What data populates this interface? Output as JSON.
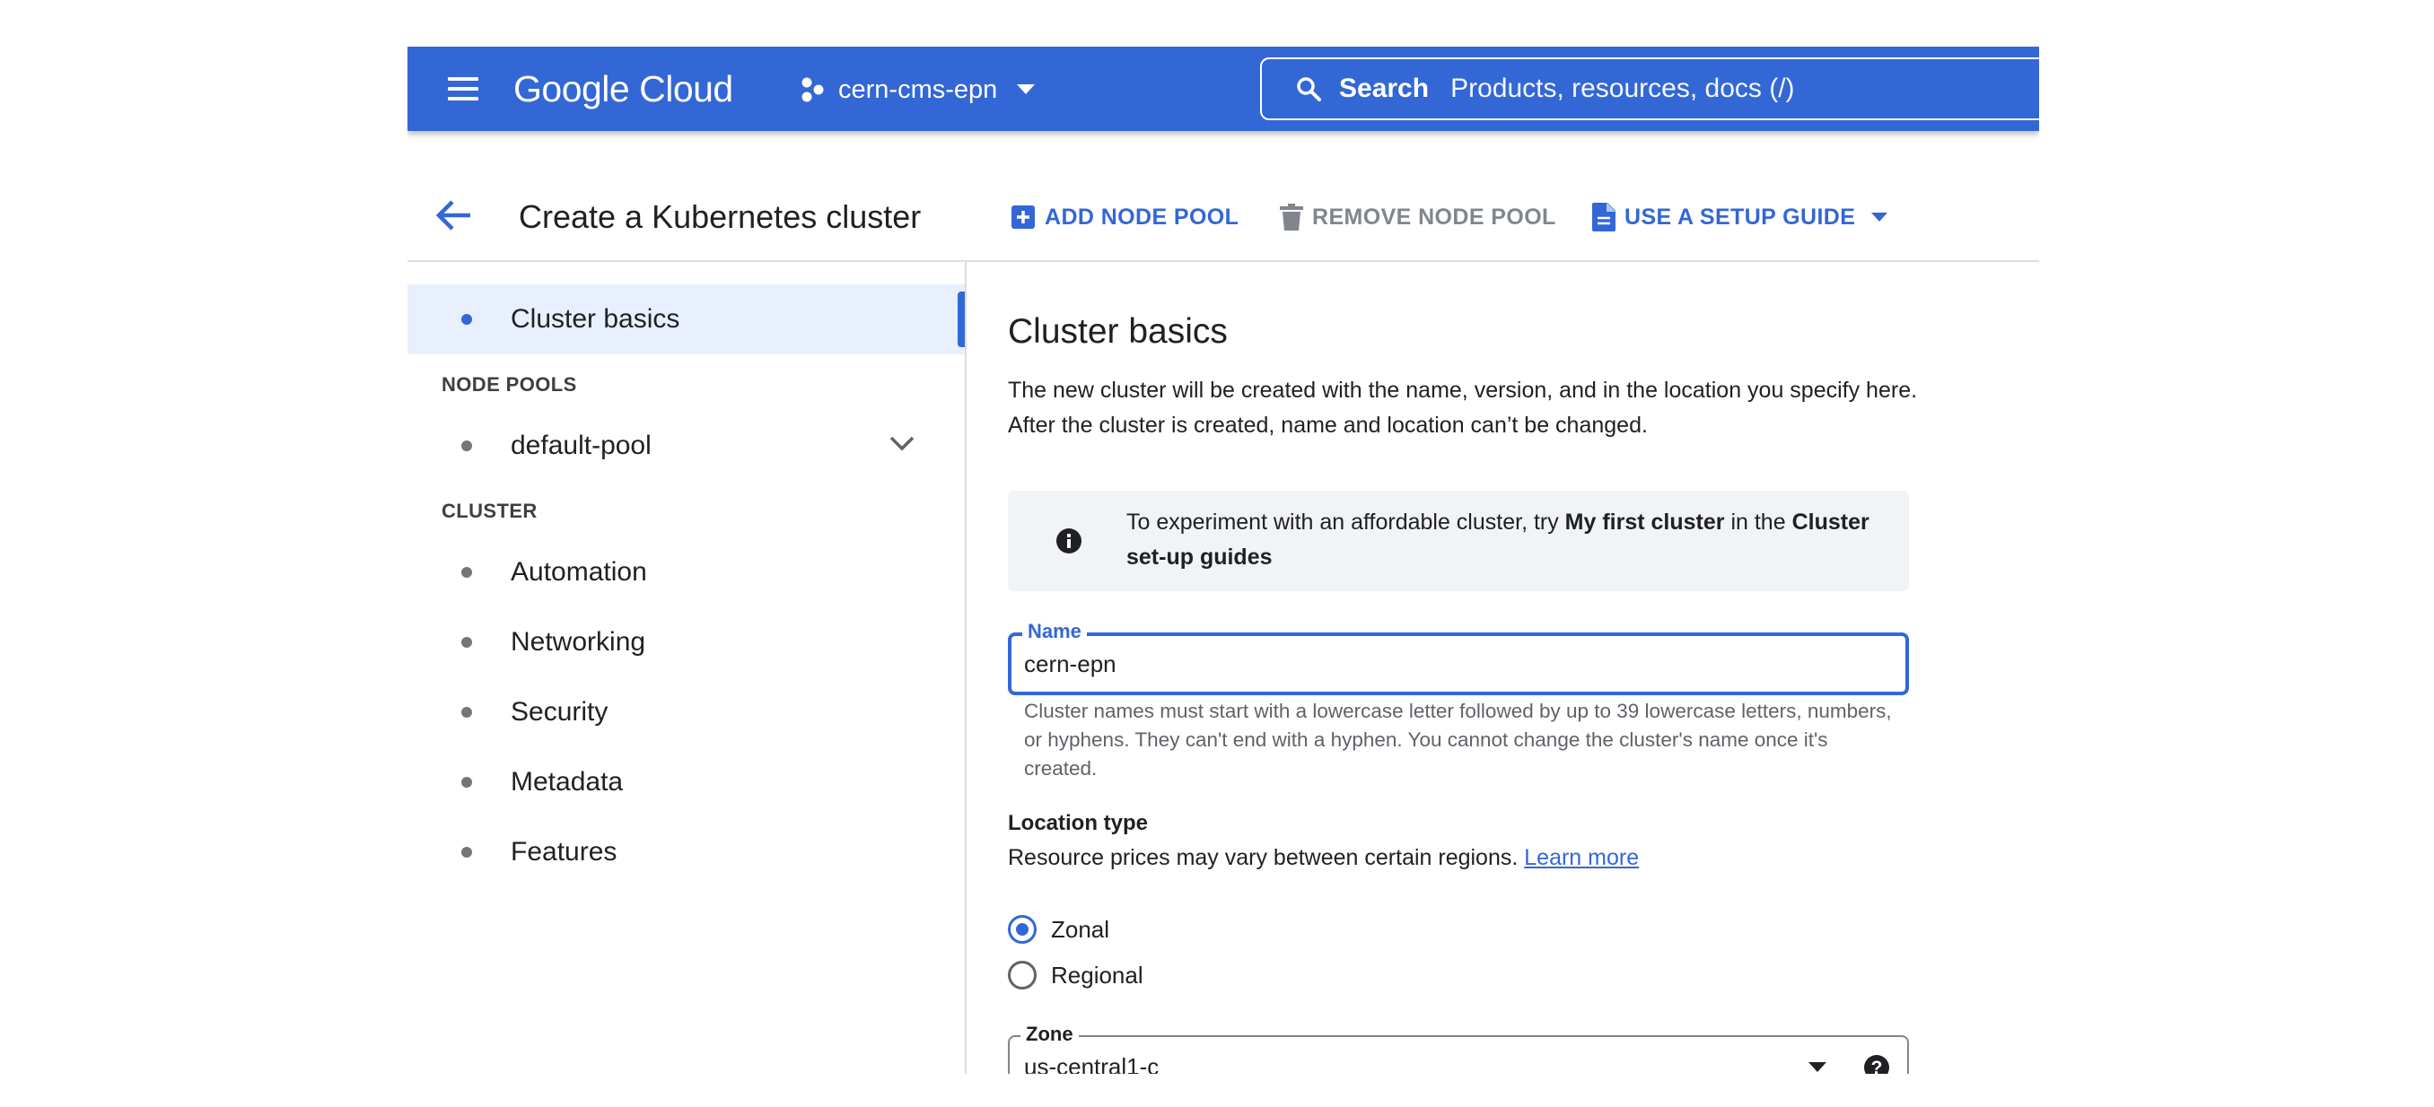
{
  "topbar": {
    "logo_text": "Google Cloud",
    "project_name": "cern-cms-epn",
    "search_label": "Search",
    "search_placeholder": "Products, resources, docs (/)",
    "bar_color": "#3367d6"
  },
  "header": {
    "title": "Create a Kubernetes cluster",
    "add_node_pool": "ADD NODE POOL",
    "remove_node_pool": "REMOVE NODE POOL",
    "use_setup_guide": "USE A SETUP GUIDE"
  },
  "sidebar": {
    "top_item": "Cluster basics",
    "node_pools_label": "NODE POOLS",
    "node_pool_item": "default-pool",
    "cluster_label": "CLUSTER",
    "cluster_items": [
      "Automation",
      "Networking",
      "Security",
      "Metadata",
      "Features"
    ]
  },
  "main": {
    "heading": "Cluster basics",
    "intro": "The new cluster will be created with the name, version, and in the location you specify here. After the cluster is created, name and location can’t be changed.",
    "info": {
      "prefix": "To experiment with an affordable cluster, try ",
      "bold1": "My first cluster",
      "middle": " in the ",
      "bold2": "Cluster set-up guides"
    },
    "name_field": {
      "label": "Name",
      "value": "cern-epn",
      "hint": "Cluster names must start with a lowercase letter followed by up to 39 lowercase letters, numbers, or hyphens. They can't end with a hyphen. You cannot change the cluster's name once it's created."
    },
    "location": {
      "title": "Location type",
      "description": "Resource prices may vary between certain regions.",
      "learn_more": "Learn more",
      "options": [
        "Zonal",
        "Regional"
      ],
      "selected": "Zonal"
    },
    "zone_field": {
      "label": "Zone",
      "value": "us-central1-c"
    }
  }
}
